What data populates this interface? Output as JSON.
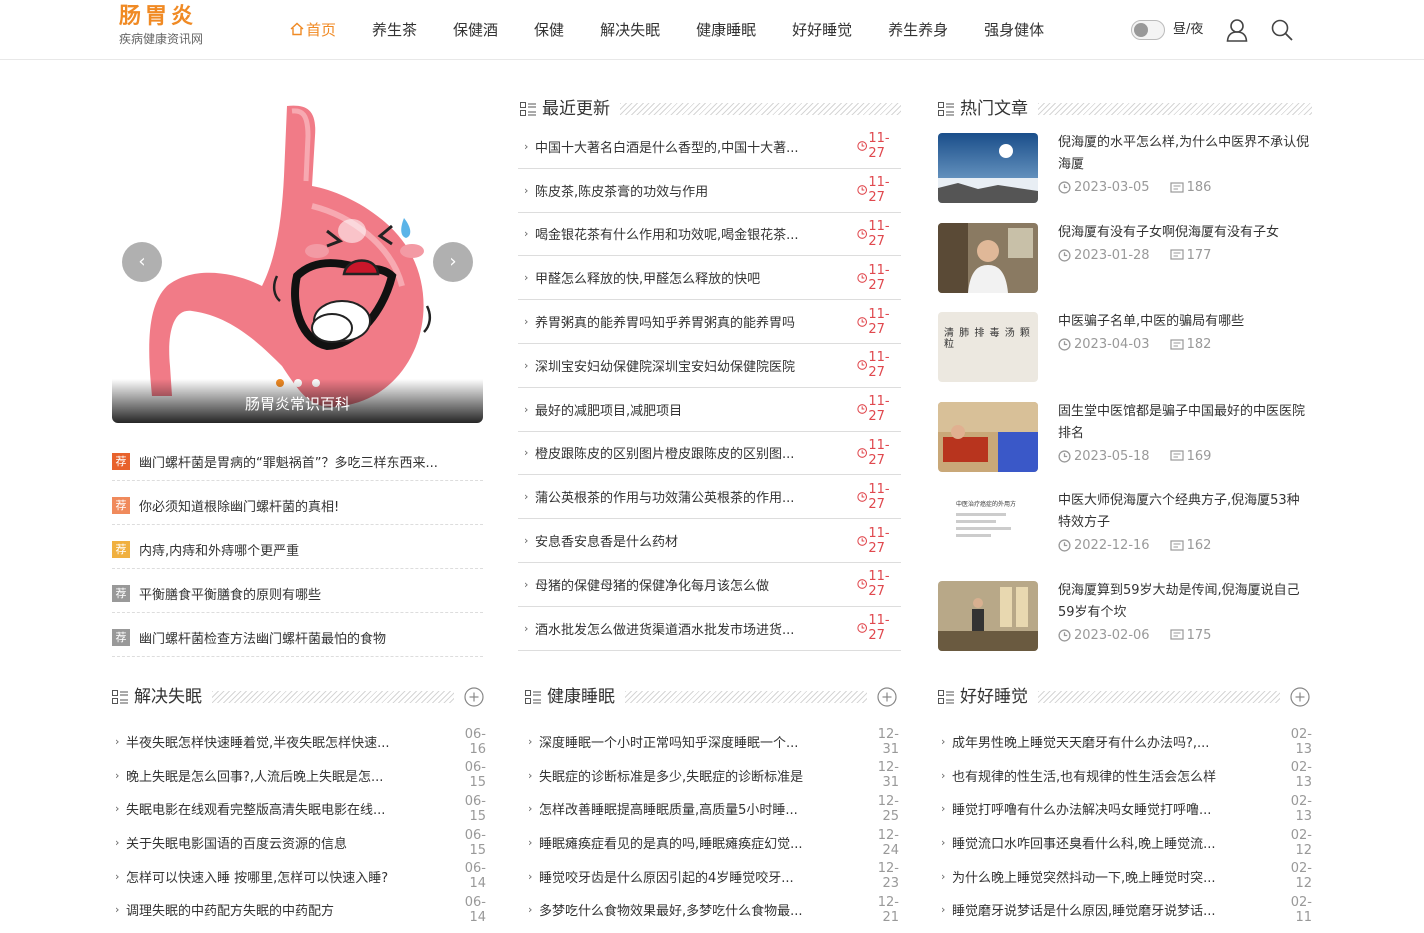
{
  "header": {
    "logo_title": "肠胃炎",
    "logo_sub": "疾病健康资讯网",
    "nav": [
      "首页",
      "养生茶",
      "保健酒",
      "保健",
      "解决失眠",
      "健康睡眠",
      "好好睡觉",
      "养生养身",
      "强身健体"
    ],
    "daynight_label": "昼/夜",
    "accent_color": "#f08a24"
  },
  "slider": {
    "caption": "肠胃炎常识百科",
    "prev_label": "‹",
    "next_label": "›"
  },
  "recommended": {
    "badge": "荐",
    "items": [
      {
        "text": "幽门螺杆菌是胃病的“罪魁祸首”？多吃三样东西来...",
        "color": "#e8622c"
      },
      {
        "text": "你必须知道根除幽门螺杆菌的真相!",
        "color": "#f08a5c"
      },
      {
        "text": "内痔,内痔和外痔哪个更严重",
        "color": "#f0b040"
      },
      {
        "text": "平衡膳食平衡膳食的原则有哪些",
        "color": "#999999"
      },
      {
        "text": "幽门螺杆菌检查方法幽门螺杆菌最怕的食物",
        "color": "#999999"
      }
    ]
  },
  "recent": {
    "title": "最近更新",
    "items": [
      {
        "text": "中国十大著名白酒是什么香型的,中国十大著...",
        "date": "11-27"
      },
      {
        "text": "陈皮茶,陈皮茶膏的功效与作用",
        "date": "11-27"
      },
      {
        "text": "喝金银花茶有什么作用和功效呢,喝金银花茶...",
        "date": "11-27"
      },
      {
        "text": "甲醛怎么释放的快,甲醛怎么释放的快吧",
        "date": "11-27"
      },
      {
        "text": "养胃粥真的能养胃吗知乎养胃粥真的能养胃吗",
        "date": "11-27"
      },
      {
        "text": "深圳宝安妇幼保健院深圳宝安妇幼保健院医院",
        "date": "11-27"
      },
      {
        "text": "最好的减肥项目,减肥项目",
        "date": "11-27"
      },
      {
        "text": "橙皮跟陈皮的区别图片橙皮跟陈皮的区别图...",
        "date": "11-27"
      },
      {
        "text": "蒲公英根茶的作用与功效蒲公英根茶的作用...",
        "date": "11-27"
      },
      {
        "text": "安息香安息香是什么药材",
        "date": "11-27"
      },
      {
        "text": "母猪的保健母猪的保健净化每月该怎么做",
        "date": "11-27"
      },
      {
        "text": "酒水批发怎么做进货渠道酒水批发市场进货...",
        "date": "11-27"
      }
    ]
  },
  "hot": {
    "title": "热门文章",
    "items": [
      {
        "title": "倪海厦的水平怎么样,为什么中医界不承认倪海厦",
        "date": "2023-03-05",
        "views": "186"
      },
      {
        "title": "倪海厦有没有子女啊倪海厦有没有子女",
        "date": "2023-01-28",
        "views": "177"
      },
      {
        "title": "中医骗子名单,中医的骗局有哪些",
        "date": "2023-04-03",
        "views": "182",
        "thumb_text": "清 肺 排 毒 汤 颗 粒"
      },
      {
        "title": "固生堂中医馆都是骗子中国最好的中医医院排名",
        "date": "2023-05-18",
        "views": "169"
      },
      {
        "title": "中医大师倪海厦六个经典方子,倪海厦53种特效方子",
        "date": "2022-12-16",
        "views": "162",
        "thumb_text": "中医治疗癌症的外用方"
      },
      {
        "title": "倪海厦算到59岁大劫是传闻,倪海厦说自己59岁有个坎",
        "date": "2023-02-06",
        "views": "175"
      }
    ]
  },
  "columns": [
    {
      "title": "解决失眠",
      "items": [
        {
          "text": "半夜失眠怎样快速睡着觉,半夜失眠怎样快速...",
          "date": "06-16"
        },
        {
          "text": "晚上失眠是怎么回事?,人流后晚上失眠是怎...",
          "date": "06-15"
        },
        {
          "text": "失眠电影在线观看完整版高清失眠电影在线...",
          "date": "06-15"
        },
        {
          "text": "关于失眠电影国语的百度云资源的信息",
          "date": "06-15"
        },
        {
          "text": "怎样可以快速入睡 按哪里,怎样可以快速入睡?",
          "date": "06-14"
        },
        {
          "text": "调理失眠的中药配方失眠的中药配方",
          "date": "06-14"
        }
      ]
    },
    {
      "title": "健康睡眠",
      "items": [
        {
          "text": "深度睡眠一个小时正常吗知乎深度睡眠一个...",
          "date": "12-31"
        },
        {
          "text": "失眠症的诊断标准是多少,失眠症的诊断标准是",
          "date": "12-31"
        },
        {
          "text": "怎样改善睡眠提高睡眠质量,高质量5小时睡...",
          "date": "12-25"
        },
        {
          "text": "睡眠瘫痪症看见的是真的吗,睡眠瘫痪症幻觉...",
          "date": "12-24"
        },
        {
          "text": "睡觉咬牙齿是什么原因引起的4岁睡觉咬牙...",
          "date": "12-23"
        },
        {
          "text": "多梦吃什么食物效果最好,多梦吃什么食物最...",
          "date": "12-21"
        }
      ]
    },
    {
      "title": "好好睡觉",
      "items": [
        {
          "text": "成年男性晚上睡觉天天磨牙有什么办法吗?,...",
          "date": "02-13"
        },
        {
          "text": "也有规律的性生活,也有规律的性生活会怎么样",
          "date": "02-13"
        },
        {
          "text": "睡觉打呼噜有什么办法解决吗女睡觉打呼噜...",
          "date": "02-13"
        },
        {
          "text": "睡觉流口水咋回事还臭看什么科,晚上睡觉流...",
          "date": "02-12"
        },
        {
          "text": "为什么晚上睡觉突然抖动一下,晚上睡觉时突...",
          "date": "02-12"
        },
        {
          "text": "睡觉磨牙说梦话是什么原因,睡觉磨牙说梦话...",
          "date": "02-11"
        }
      ]
    }
  ]
}
